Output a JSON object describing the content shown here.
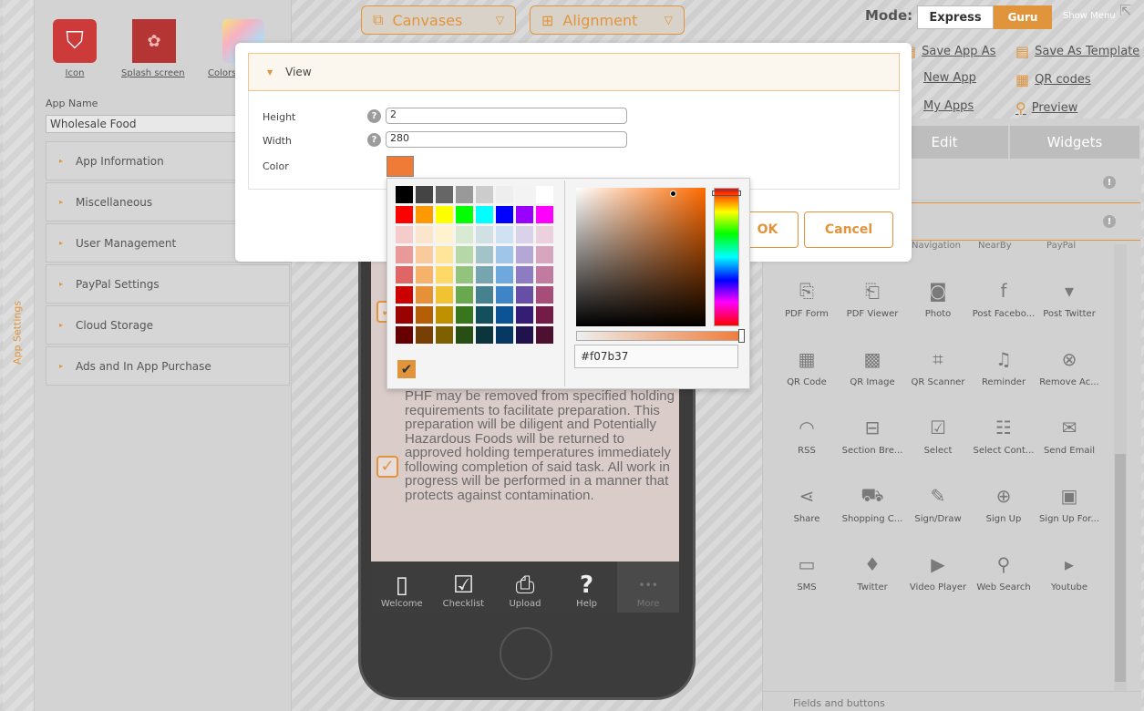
{
  "colors": {
    "accent": "#e0953d",
    "picked": "#f07b37"
  },
  "side_tab": {
    "label": "App Settings"
  },
  "top_icons": [
    {
      "label": "Icon",
      "icon": "shield-icon"
    },
    {
      "label": "Splash screen",
      "icon": "splash-image-icon"
    },
    {
      "label": "Colors",
      "icon": "palette-icon"
    }
  ],
  "app_name": {
    "label": "App Name",
    "value": "Wholesale Food"
  },
  "accordion": [
    "App Information",
    "Miscellaneous",
    "User Management",
    "PayPal Settings",
    "Cloud Storage",
    "Ads and In App Purchase"
  ],
  "toolbar": {
    "canvases": "Canvases",
    "alignment": "Alignment"
  },
  "mode": {
    "label": "Mode:",
    "express": "Express",
    "guru": "Guru",
    "show_menu": "Show Menu"
  },
  "links": {
    "save_app_as": "Save App As",
    "save_as_template": "Save As Template",
    "new_app": "New App",
    "qr_codes": "QR codes",
    "my_apps": "My Apps",
    "preview": "Preview"
  },
  "right_tabs": {
    "edit": "Edit",
    "widgets": "Widgets"
  },
  "widgets_partial": [
    "Navigation",
    "NearBy",
    "PayPal"
  ],
  "widgets": [
    {
      "label": "PDF Form",
      "icon": "pdf-form-icon",
      "glyph": "⎘"
    },
    {
      "label": "PDF Viewer",
      "icon": "pdf-viewer-icon",
      "glyph": "⎗"
    },
    {
      "label": "Photo",
      "icon": "camera-icon",
      "glyph": "◙"
    },
    {
      "label": "Post Facebo...",
      "icon": "facebook-icon",
      "glyph": "f"
    },
    {
      "label": "Post Twitter",
      "icon": "twitter-post-icon",
      "glyph": "▾"
    },
    {
      "label": "QR Code",
      "icon": "qr-code-icon",
      "glyph": "▦"
    },
    {
      "label": "QR Image",
      "icon": "qr-image-icon",
      "glyph": "▩"
    },
    {
      "label": "QR Scanner",
      "icon": "qr-scanner-icon",
      "glyph": "⌗"
    },
    {
      "label": "Reminder",
      "icon": "bell-icon",
      "glyph": "♫"
    },
    {
      "label": "Remove Ac...",
      "icon": "remove-account-icon",
      "glyph": "⊗"
    },
    {
      "label": "RSS",
      "icon": "rss-icon",
      "glyph": "◠"
    },
    {
      "label": "Section Bre...",
      "icon": "section-break-icon",
      "glyph": "⊟"
    },
    {
      "label": "Select",
      "icon": "select-check-icon",
      "glyph": "☑"
    },
    {
      "label": "Select Cont...",
      "icon": "select-contact-icon",
      "glyph": "☷"
    },
    {
      "label": "Send Email",
      "icon": "email-icon",
      "glyph": "✉"
    },
    {
      "label": "Share",
      "icon": "share-icon",
      "glyph": "⋖"
    },
    {
      "label": "Shopping C...",
      "icon": "shopping-cart-icon",
      "glyph": "⛟"
    },
    {
      "label": "Sign/Draw",
      "icon": "pen-icon",
      "glyph": "✎"
    },
    {
      "label": "Sign Up",
      "icon": "sign-up-icon",
      "glyph": "⊕"
    },
    {
      "label": "Sign Up For...",
      "icon": "sign-up-form-icon",
      "glyph": "▣"
    },
    {
      "label": "SMS",
      "icon": "sms-icon",
      "glyph": "▭"
    },
    {
      "label": "Twitter",
      "icon": "twitter-icon",
      "glyph": "♦"
    },
    {
      "label": "Video Player",
      "icon": "play-icon",
      "glyph": "▶"
    },
    {
      "label": "Web Search",
      "icon": "magnifier-icon",
      "glyph": "⚲"
    },
    {
      "label": "Youtube",
      "icon": "youtube-icon",
      "glyph": "▸"
    }
  ],
  "fields_and_buttons": "Fields and buttons",
  "modal": {
    "section_title": "View",
    "height_label": "Height",
    "height_value": "2",
    "width_label": "Width",
    "width_value": "280",
    "color_label": "Color",
    "ok": "OK",
    "cancel": "Cancel"
  },
  "picker": {
    "hex": "#f07b37",
    "palette": [
      "#000000",
      "#444444",
      "#666666",
      "#999999",
      "#cccccc",
      "#eeeeee",
      "#f3f3f3",
      "#ffffff",
      "#ff0000",
      "#ff9900",
      "#ffff00",
      "#00ff00",
      "#00ffff",
      "#0000ff",
      "#9900ff",
      "#ff00ff",
      "#f4cccc",
      "#fce5cd",
      "#fff2cc",
      "#d9ead3",
      "#d0e0e3",
      "#cfe2f3",
      "#d9d2e9",
      "#ead1dc",
      "#ea9999",
      "#f9cb9c",
      "#ffe599",
      "#b6d7a8",
      "#a2c4c9",
      "#9fc5e8",
      "#b4a7d6",
      "#d5a6bd",
      "#e06666",
      "#f6b26b",
      "#ffd966",
      "#93c47d",
      "#76a5af",
      "#6fa8dc",
      "#8e7cc3",
      "#c27ba0",
      "#cc0000",
      "#e69138",
      "#f1c232",
      "#6aa84f",
      "#45818e",
      "#3d85c6",
      "#674ea7",
      "#a64d79",
      "#990000",
      "#b45f06",
      "#bf9000",
      "#38761d",
      "#134f5c",
      "#0b5394",
      "#351c75",
      "#741b47",
      "#660000",
      "#783f04",
      "#7f6000",
      "#274e13",
      "#0c343d",
      "#073763",
      "#20124d",
      "#4c1130"
    ]
  },
  "phone": {
    "body_text": "PHF may be removed from specified holding requirements to facilitate preparation. This preparation will be diligent and Potentially Hazardous Foods will be returned to approved holding temperatures immediately following completion of said task. All work in progress will be performed in a manner that protects against contamination.",
    "tabs": [
      {
        "label": "Welcome",
        "icon": "phone-icon",
        "glyph": "▯"
      },
      {
        "label": "Checklist",
        "icon": "checklist-icon",
        "glyph": "☑"
      },
      {
        "label": "Upload",
        "icon": "pdf-upload-icon",
        "glyph": "⎙"
      },
      {
        "label": "Help",
        "icon": "help-icon",
        "glyph": "?"
      },
      {
        "label": "More",
        "icon": "more-dots-icon",
        "glyph": "•••"
      }
    ]
  }
}
